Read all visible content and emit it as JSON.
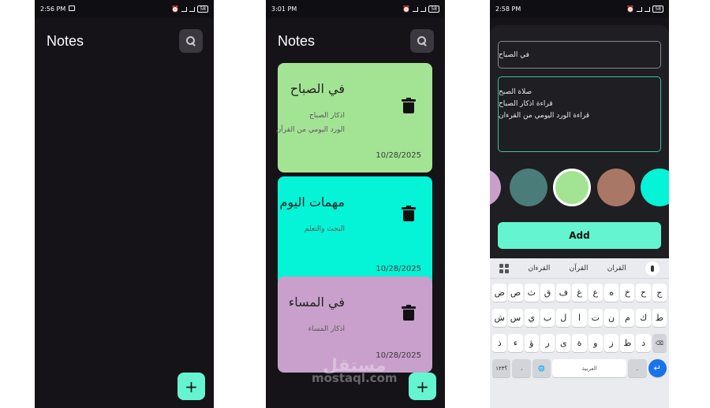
{
  "colors": {
    "green": "#a3e494",
    "cyan": "#05f3d6",
    "lilac": "#c99fcb",
    "teal": "#4a7c7a",
    "brown": "#a87765",
    "mint": "#64f5d0",
    "bg": "#151318"
  },
  "screen1": {
    "status": {
      "time": "2:56 PM",
      "battery": "58"
    },
    "app_title": "Notes",
    "search_icon": "search-icon",
    "fab_label": "+"
  },
  "screen2": {
    "status": {
      "time": "3:01 PM",
      "battery": "58"
    },
    "app_title": "Notes",
    "fab_label": "+",
    "notes": [
      {
        "title": "في الصباح",
        "lines": [
          "اذكار الصباح",
          "الورد اليومي من القرآن"
        ],
        "date": "10/28/2025",
        "color": "#a3e494"
      },
      {
        "title": "مهمات اليوم",
        "lines": [
          "البحث والتعلم"
        ],
        "date": "10/28/2025",
        "color": "#05f3d6"
      },
      {
        "title": "في المساء",
        "lines": [
          "اذكار المساء"
        ],
        "date": "10/28/2025",
        "color": "#c99fcb"
      }
    ]
  },
  "screen3": {
    "status": {
      "time": "2:58 PM",
      "battery": "58"
    },
    "title_value": "في الصباح",
    "body_lines": [
      "صلاة الصبح",
      "قراءة اذكار الصباح",
      "قراءة الورد اليومي من القرءان"
    ],
    "swatches": [
      "#c99fcb",
      "#4a7c7a",
      "#a3e494",
      "#a87765",
      "#05f3d6"
    ],
    "add_label": "Add",
    "keyboard": {
      "suggestions": [
        "القرءان",
        "القرآن",
        "القران"
      ],
      "row1": [
        "ج",
        "ح",
        "خ",
        "ه",
        "ع",
        "غ",
        "ف",
        "ق",
        "ث",
        "ص",
        "ض"
      ],
      "row2": [
        "ط",
        "ك",
        "م",
        "ن",
        "ت",
        "ا",
        "ل",
        "ب",
        "ي",
        "س",
        "ش"
      ],
      "row3": [
        "د",
        "ظ",
        "ز",
        "و",
        "ة",
        "ى",
        "ر",
        "ؤ",
        "ء",
        "ذ"
      ],
      "row4": {
        "symbols": "؟١٢٣",
        "comma": "،",
        "space": "العربية",
        "period": "."
      }
    }
  },
  "watermark": {
    "arabic": "مستقل",
    "latin": "mostaql.com"
  }
}
